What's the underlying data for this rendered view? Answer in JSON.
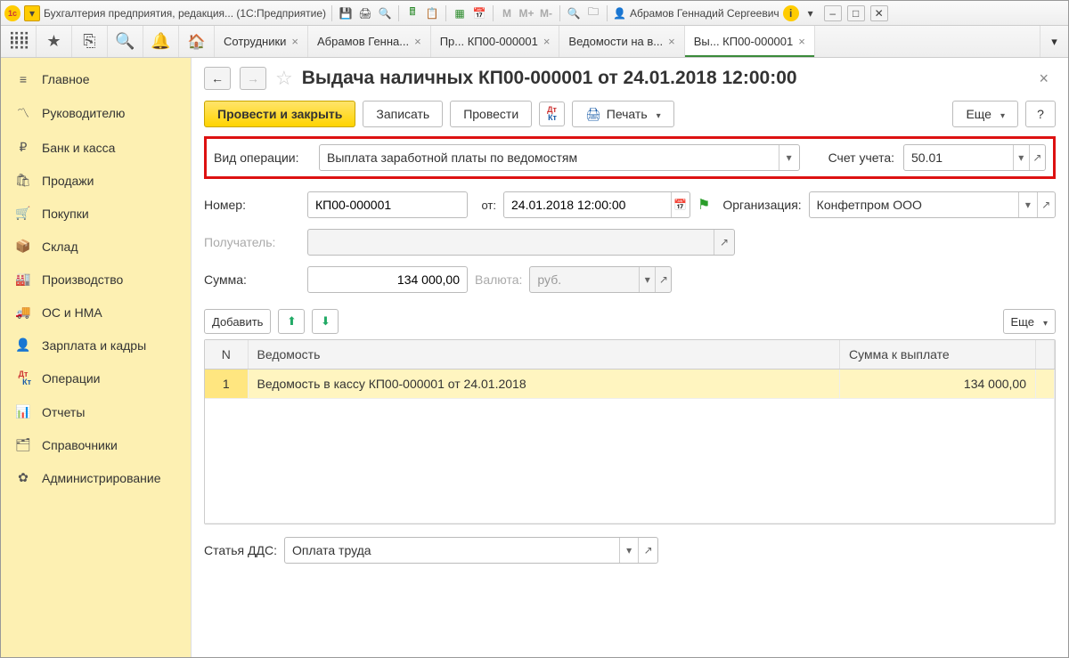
{
  "titlebar": {
    "app_title": "Бухгалтерия предприятия, редакция... (1С:Предприятие)",
    "user_name": "Абрамов Геннадий Сергеевич"
  },
  "tabs": [
    {
      "label": "Сотрудники"
    },
    {
      "label": "Абрамов Генна..."
    },
    {
      "label": "Пр... КП00-000001"
    },
    {
      "label": "Ведомости на в..."
    },
    {
      "label": "Вы... КП00-000001",
      "active": true
    }
  ],
  "sidebar": [
    {
      "icon": "≡",
      "label": "Главное"
    },
    {
      "icon": "📈",
      "label": "Руководителю"
    },
    {
      "icon": "₽",
      "label": "Банк и касса"
    },
    {
      "icon": "🛍",
      "label": "Продажи"
    },
    {
      "icon": "🛒",
      "label": "Покупки"
    },
    {
      "icon": "📦",
      "label": "Склад"
    },
    {
      "icon": "🏭",
      "label": "Производство"
    },
    {
      "icon": "🚚",
      "label": "ОС и НМА"
    },
    {
      "icon": "👤",
      "label": "Зарплата и кадры"
    },
    {
      "icon": "Дт/Кт",
      "label": "Операции"
    },
    {
      "icon": "📊",
      "label": "Отчеты"
    },
    {
      "icon": "🗂",
      "label": "Справочники"
    },
    {
      "icon": "⚙",
      "label": "Администрирование"
    }
  ],
  "doc": {
    "title": "Выдача наличных КП00-000001 от 24.01.2018 12:00:00",
    "toolbar": {
      "post_close": "Провести и закрыть",
      "save": "Записать",
      "post": "Провести",
      "print": "Печать",
      "more": "Еще",
      "help": "?"
    },
    "fields": {
      "op_type_label": "Вид операции:",
      "op_type_value": "Выплата заработной платы по ведомостям",
      "account_label": "Счет учета:",
      "account_value": "50.01",
      "number_label": "Номер:",
      "number_value": "КП00-000001",
      "date_label": "от:",
      "date_value": "24.01.2018 12:00:00",
      "org_label": "Организация:",
      "org_value": "Конфетпром ООО",
      "recipient_label": "Получатель:",
      "recipient_value": "",
      "sum_label": "Сумма:",
      "sum_value": "134 000,00",
      "currency_label": "Валюта:",
      "currency_value": "руб.",
      "add": "Добавить",
      "more2": "Еще"
    },
    "table": {
      "col_n": "N",
      "col_vedomost": "Ведомость",
      "col_sum": "Сумма к выплате",
      "rows": [
        {
          "n": "1",
          "vedomost": "Ведомость в кассу КП00-000001 от 24.01.2018",
          "sum": "134 000,00"
        }
      ]
    },
    "bottom": {
      "dds_label": "Статья ДДС:",
      "dds_value": "Оплата труда"
    }
  }
}
